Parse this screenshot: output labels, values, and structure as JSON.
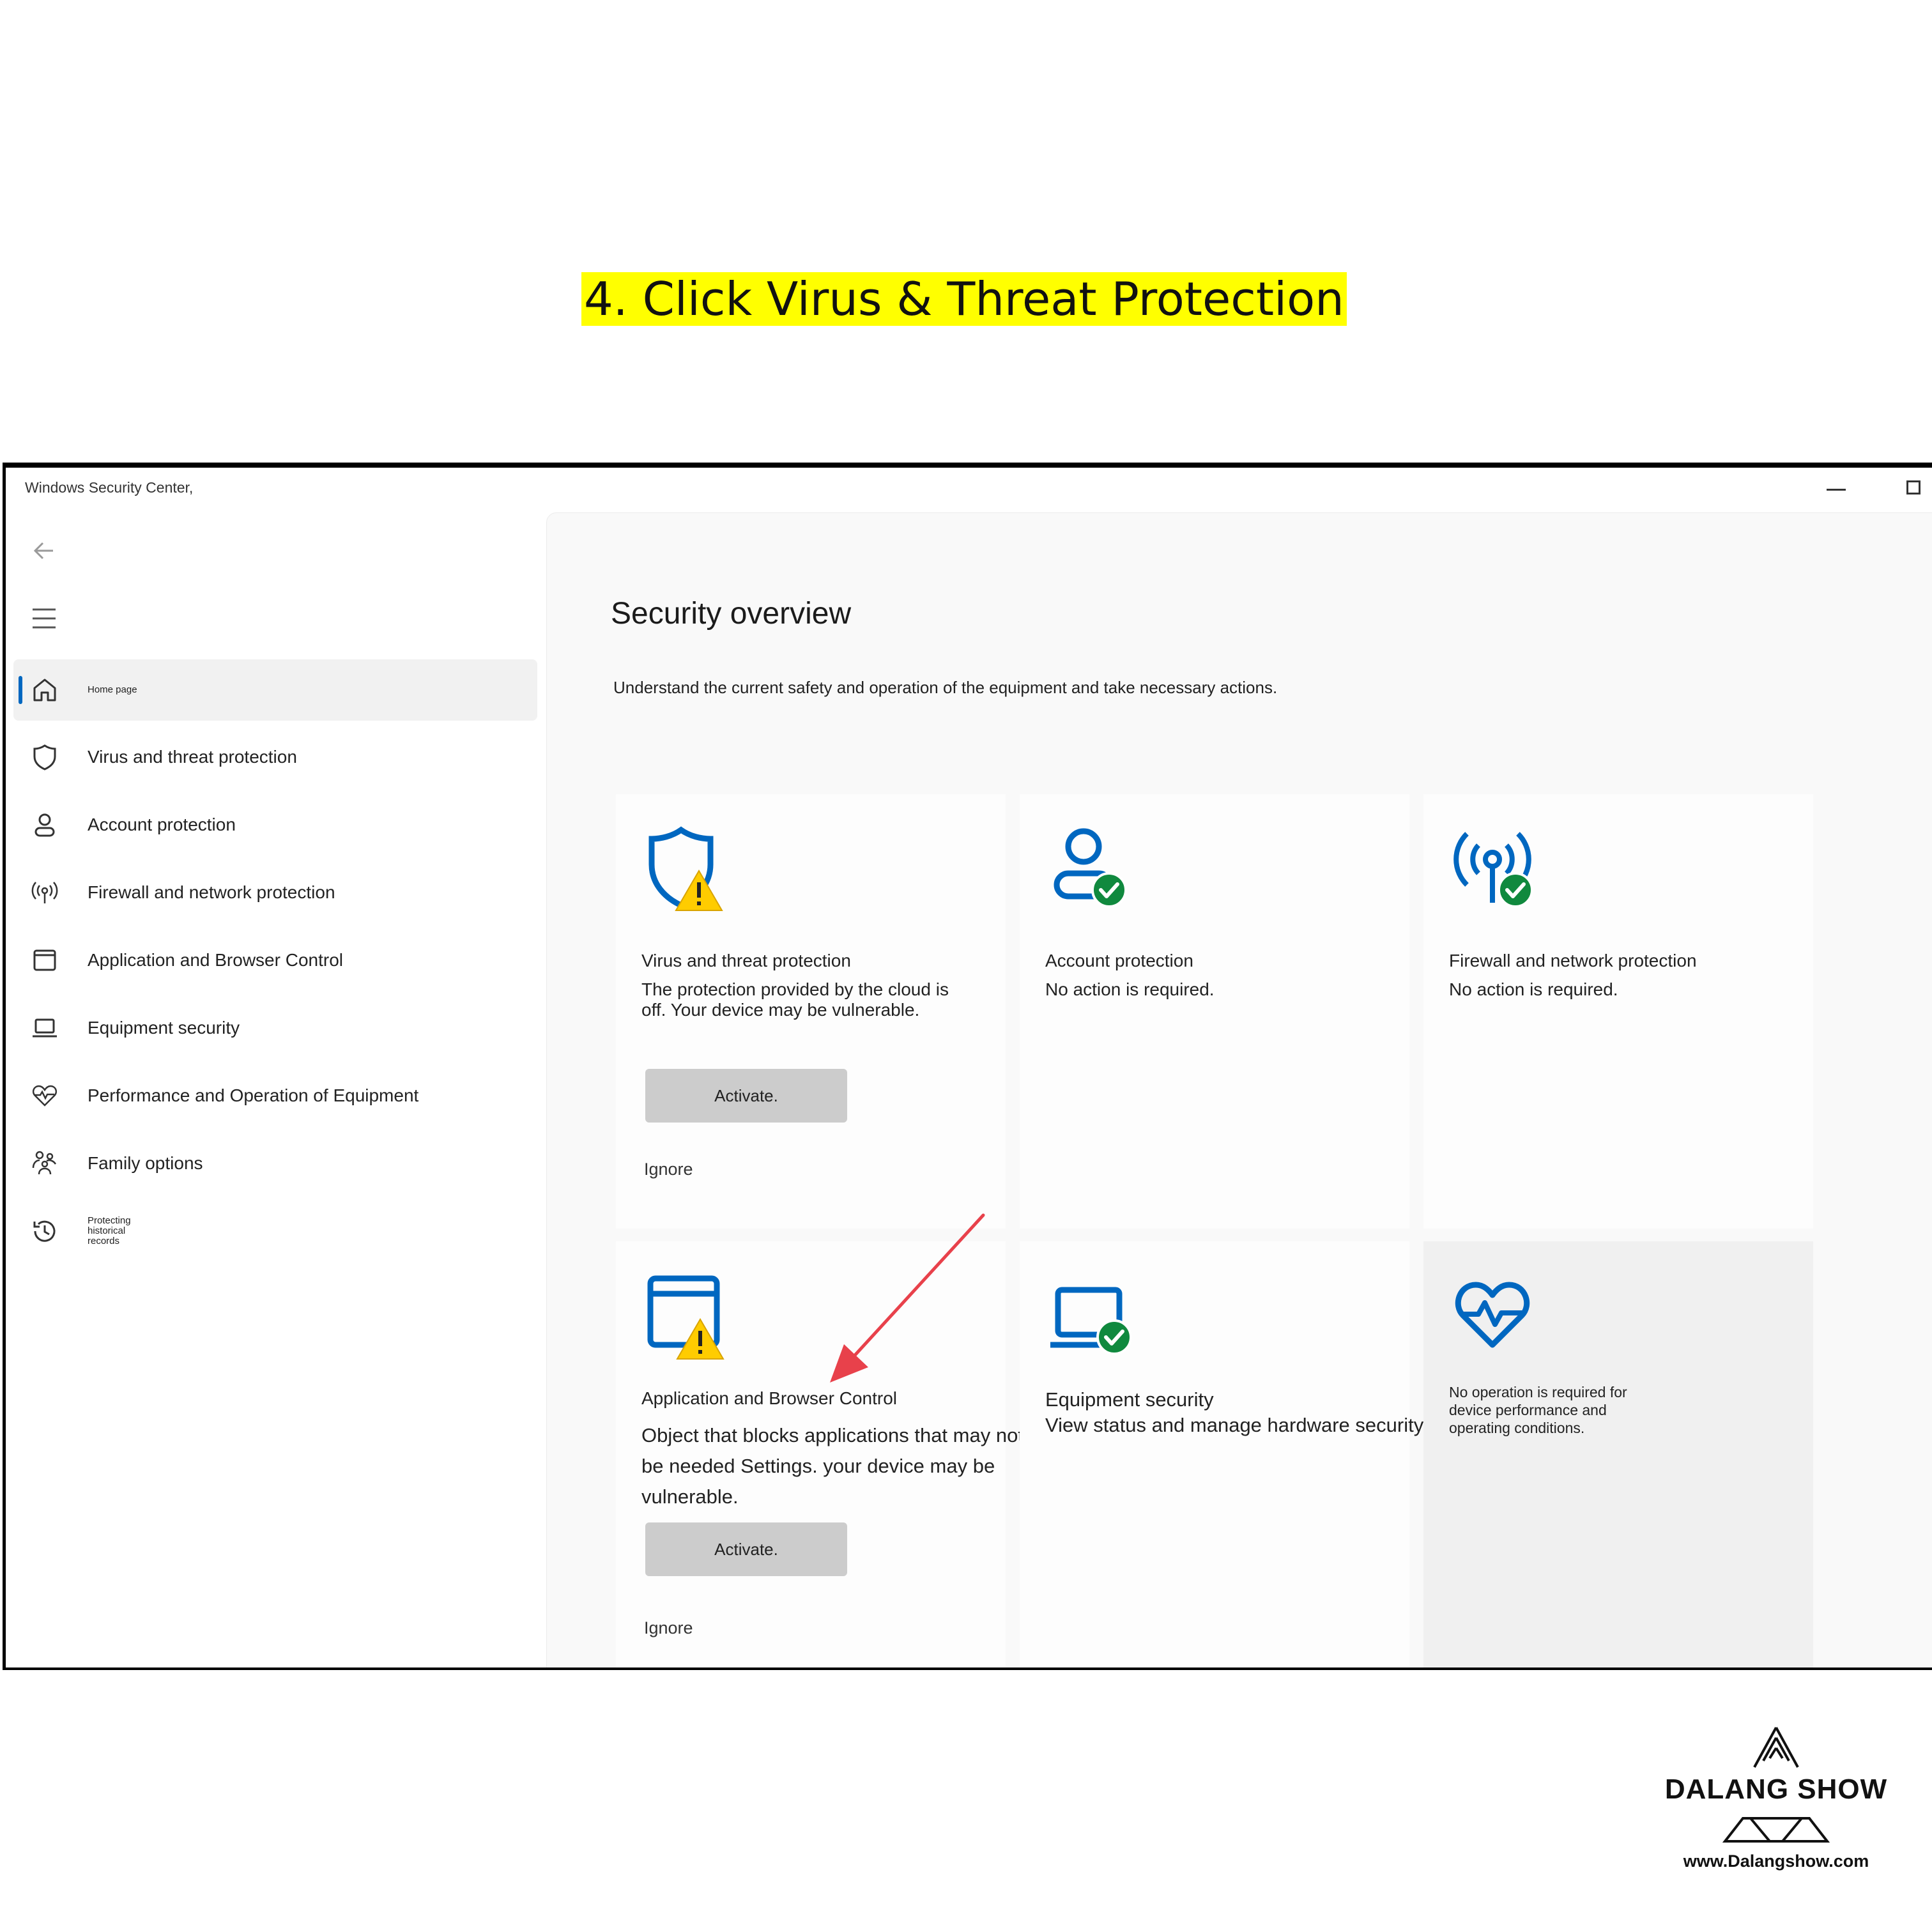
{
  "banner": {
    "text": "4. Click Virus & Threat Protection"
  },
  "window": {
    "title": "Windows Security Center,"
  },
  "sidebar": {
    "items": [
      {
        "label": "Home page",
        "icon": "home-icon",
        "active": true
      },
      {
        "label": "Virus and threat protection",
        "icon": "shield-icon"
      },
      {
        "label": "Account protection",
        "icon": "person-icon"
      },
      {
        "label": "Firewall and network protection",
        "icon": "antenna-icon"
      },
      {
        "label": "Application and Browser Control",
        "icon": "app-window-icon"
      },
      {
        "label": "Equipment security",
        "icon": "laptop-icon"
      },
      {
        "label": "Performance and Operation of Equipment",
        "icon": "heart-pulse-icon"
      },
      {
        "label": "Family options",
        "icon": "family-icon"
      },
      {
        "label": "Protecting historical records",
        "icon": "history-icon"
      }
    ]
  },
  "main": {
    "title": "Security overview",
    "description": "Understand the current safety and operation of the equipment and take necessary actions.",
    "cards": [
      {
        "title": "Virus and threat protection",
        "desc": "The protection provided by the cloud is off. Your device may be vulnerable.",
        "button": "Activate.",
        "ignore": "Ignore",
        "status": "warning"
      },
      {
        "title": "Account protection",
        "desc": "No action is required.",
        "status": "ok"
      },
      {
        "title": "Firewall and network protection",
        "desc": "No action is required.",
        "status": "ok"
      },
      {
        "title": "Application and Browser Control",
        "desc": "Object that blocks applications that may not be needed Settings. your device may be vulnerable.",
        "button": "Activate.",
        "ignore": "Ignore",
        "status": "warning"
      },
      {
        "title": "Equipment security",
        "desc": "View status and manage hardware security features.",
        "status": "ok"
      },
      {
        "title": "",
        "desc": "No operation is required for device performance and operating conditions.",
        "status": "ok"
      }
    ]
  },
  "colors": {
    "accent": "#0067c0",
    "ok": "#10893e",
    "warning": "#ffcc00",
    "highlight": "#ffff00",
    "arrow": "#e8414b"
  },
  "brand": {
    "name": "DALANG SHOW",
    "url": "www.Dalangshow.com"
  }
}
